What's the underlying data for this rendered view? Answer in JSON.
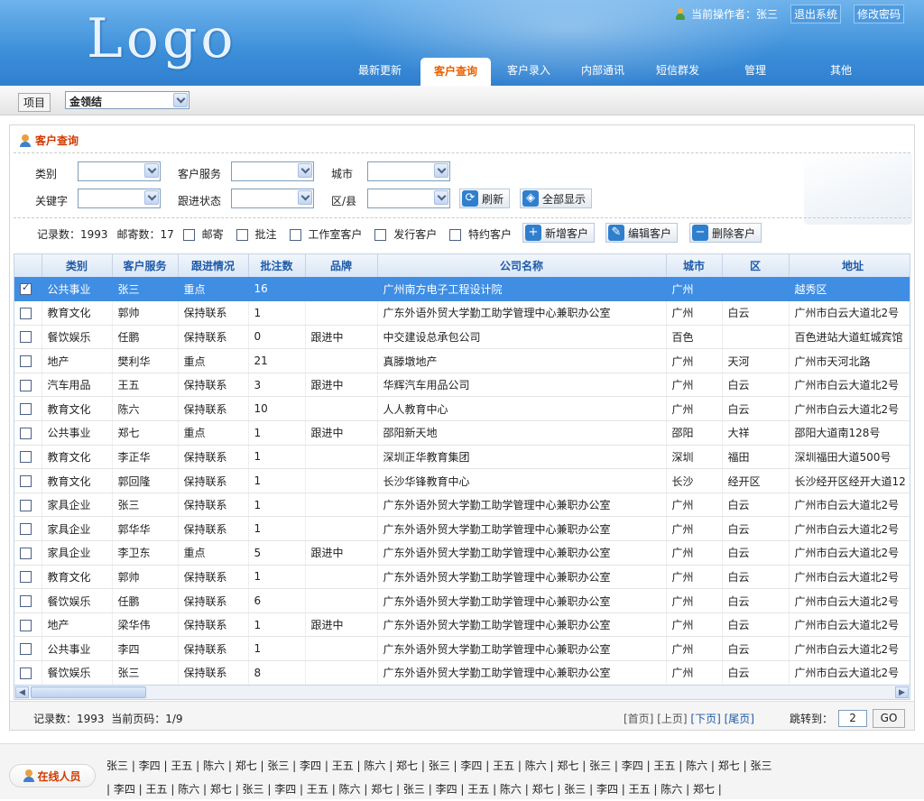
{
  "header": {
    "logo": "Logo",
    "operator_label": "当前操作者：张三",
    "logout": "退出系统",
    "change_pwd": "修改密码",
    "tabs": [
      {
        "label": "最新更新",
        "w": 90
      },
      {
        "label": "客户查询",
        "w": 78
      },
      {
        "label": "客户录入",
        "w": 84
      },
      {
        "label": "内部通讯",
        "w": 80
      },
      {
        "label": "短信群发",
        "w": 86
      },
      {
        "label": "管理",
        "w": 86
      },
      {
        "label": "其他",
        "w": 104
      }
    ],
    "active_tab": "客户查询"
  },
  "subbar": {
    "project_label": "项目",
    "project_value": "金领结"
  },
  "panel": {
    "title": "客户查询",
    "filters": {
      "category": "类别",
      "service": "客户服务",
      "city": "城市",
      "keyword": "关键字",
      "follow": "跟进状态",
      "district": "区/县",
      "refresh": "刷新",
      "show_all": "全部显示"
    },
    "stats": {
      "records": "记录数：1993",
      "mail": "邮寄数：17",
      "opts": [
        "邮寄",
        "批注",
        "工作室客户",
        "发行客户",
        "特约客户"
      ],
      "add": "新增客户",
      "edit": "编辑客户",
      "del": "删除客户"
    },
    "columns": [
      "类别",
      "客户服务",
      "跟进情况",
      "批注数",
      "品牌",
      "公司名称",
      "城市",
      "区",
      "地址"
    ],
    "rows": [
      {
        "checked": true,
        "c": [
          "公共事业",
          "张三",
          "重点",
          "16",
          "",
          "广州南方电子工程设计院",
          "广州",
          "",
          "越秀区"
        ]
      },
      {
        "c": [
          "教育文化",
          "郭帅",
          "保持联系",
          "1",
          "",
          "广东外语外贸大学勤工助学管理中心兼职办公室",
          "广州",
          "白云",
          "广州市白云大道北2号"
        ]
      },
      {
        "c": [
          "餐饮娱乐",
          "任鹏",
          "保持联系",
          "0",
          "跟进中",
          "中交建设总承包公司",
          "百色",
          "",
          "百色进站大道虹城宾馆"
        ]
      },
      {
        "c": [
          "地产",
          "樊利华",
          "重点",
          "21",
          "",
          "真滕墩地产",
          "广州",
          "天河",
          "广州市天河北路"
        ]
      },
      {
        "c": [
          "汽车用品",
          "王五",
          "保持联系",
          "3",
          "跟进中",
          "华辉汽车用品公司",
          "广州",
          "白云",
          "广州市白云大道北2号"
        ]
      },
      {
        "c": [
          "教育文化",
          "陈六",
          "保持联系",
          "10",
          "",
          "人人教育中心",
          "广州",
          "白云",
          "广州市白云大道北2号"
        ]
      },
      {
        "c": [
          "公共事业",
          "郑七",
          "重点",
          "1",
          "跟进中",
          "邵阳新天地",
          "邵阳",
          "大祥",
          "邵阳大道南128号"
        ]
      },
      {
        "c": [
          "教育文化",
          "李正华",
          "保持联系",
          "1",
          "",
          "深圳正华教育集团",
          "深圳",
          "福田",
          "深圳福田大道500号"
        ]
      },
      {
        "c": [
          "教育文化",
          "郭回隆",
          "保持联系",
          "1",
          "",
          "长沙华锋教育中心",
          "长沙",
          "经开区",
          "长沙经开区经开大道12"
        ]
      },
      {
        "c": [
          "家具企业",
          "张三",
          "保持联系",
          "1",
          "",
          "广东外语外贸大学勤工助学管理中心兼职办公室",
          "广州",
          "白云",
          "广州市白云大道北2号"
        ]
      },
      {
        "c": [
          "家具企业",
          "郭华华",
          "保持联系",
          "1",
          "",
          "广东外语外贸大学勤工助学管理中心兼职办公室",
          "广州",
          "白云",
          "广州市白云大道北2号"
        ]
      },
      {
        "c": [
          "家具企业",
          "李卫东",
          "重点",
          "5",
          "跟进中",
          "广东外语外贸大学勤工助学管理中心兼职办公室",
          "广州",
          "白云",
          "广州市白云大道北2号"
        ]
      },
      {
        "c": [
          "教育文化",
          "郭帅",
          "保持联系",
          "1",
          "",
          "广东外语外贸大学勤工助学管理中心兼职办公室",
          "广州",
          "白云",
          "广州市白云大道北2号"
        ]
      },
      {
        "c": [
          "餐饮娱乐",
          "任鹏",
          "保持联系",
          "6",
          "",
          "广东外语外贸大学勤工助学管理中心兼职办公室",
          "广州",
          "白云",
          "广州市白云大道北2号"
        ]
      },
      {
        "c": [
          "地产",
          "梁华伟",
          "保持联系",
          "1",
          "跟进中",
          "广东外语外贸大学勤工助学管理中心兼职办公室",
          "广州",
          "白云",
          "广州市白云大道北2号"
        ]
      },
      {
        "c": [
          "公共事业",
          "李四",
          "保持联系",
          "1",
          "",
          "广东外语外贸大学勤工助学管理中心兼职办公室",
          "广州",
          "白云",
          "广州市白云大道北2号"
        ]
      },
      {
        "c": [
          "餐饮娱乐",
          "张三",
          "保持联系",
          "8",
          "",
          "广东外语外贸大学勤工助学管理中心兼职办公室",
          "广州",
          "白云",
          "广州市白云大道北2号"
        ]
      }
    ],
    "pager": {
      "records": "记录数：1993",
      "page": "当前页码：1/9",
      "first": "[首页]",
      "prev": "[上页]",
      "next": "[下页]",
      "last": "[尾页]",
      "jump": "跳转到：",
      "page_input": "2",
      "go": "GO"
    }
  },
  "online": {
    "label": "在线人员",
    "line1": "张三 | 李四 | 王五 | 陈六 | 郑七 | 张三 | 李四 | 王五 | 陈六 | 郑七 | 张三 | 李四 | 王五 | 陈六 | 郑七 | 张三 | 李四 | 王五 | 陈六 | 郑七 | 张三",
    "line2": "| 李四 | 王五 | 陈六 | 郑七 | 张三 | 李四 | 王五 | 陈六 | 郑七 | 张三 | 李四 | 王五 | 陈六 | 郑七 | 张三 | 李四 | 王五 | 陈六 | 郑七 |"
  }
}
